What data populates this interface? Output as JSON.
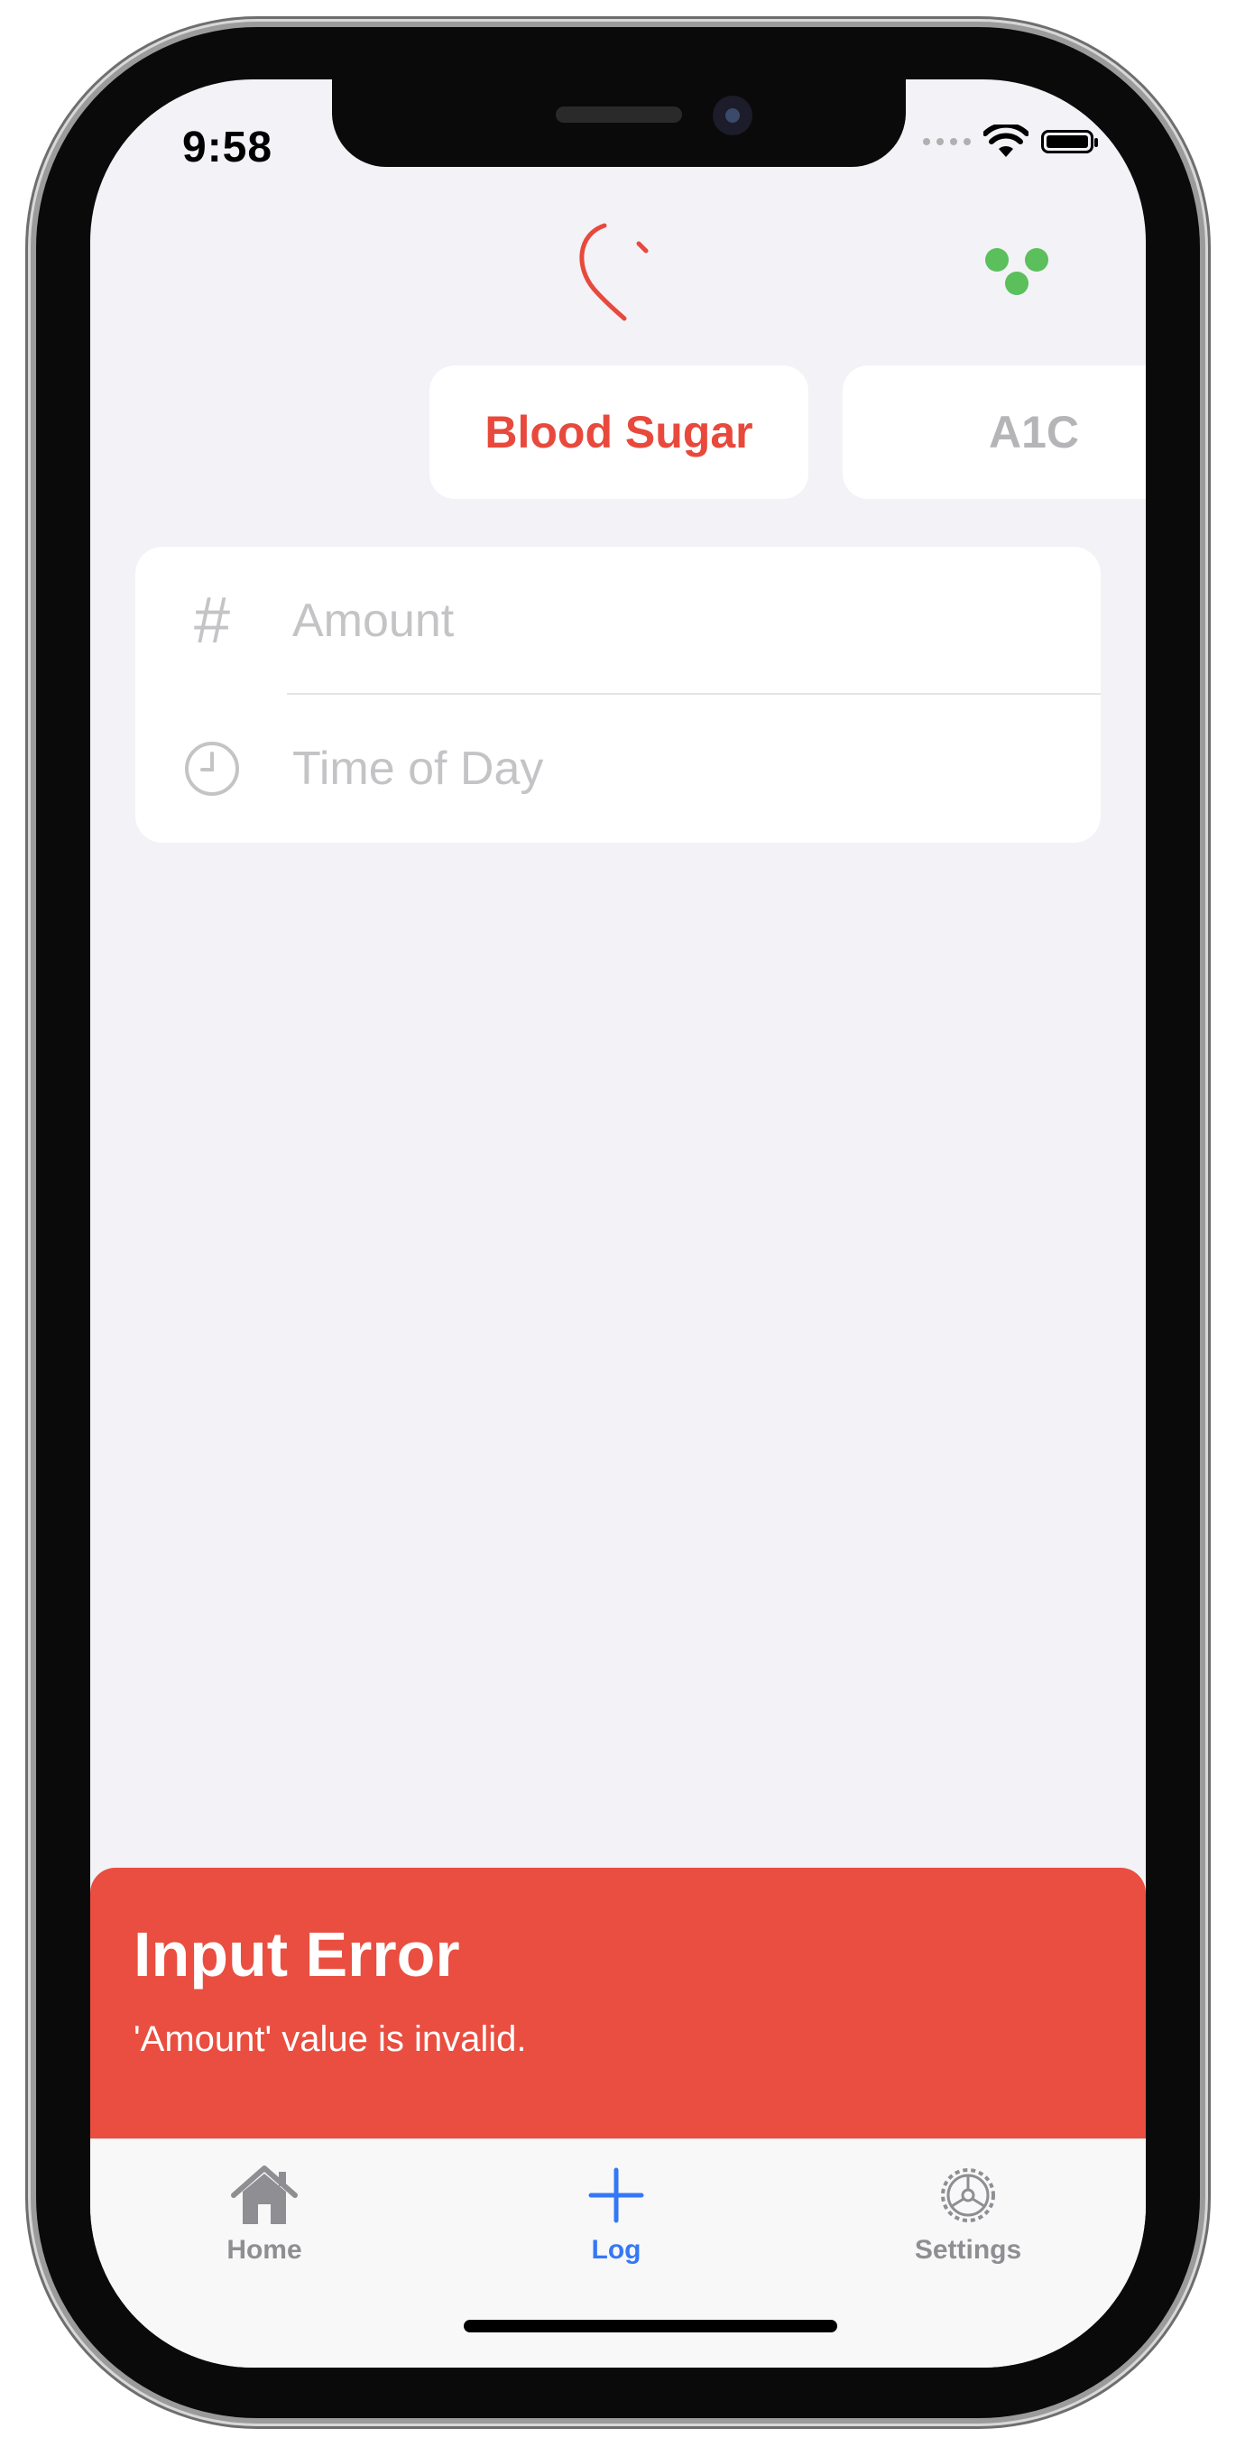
{
  "status_bar": {
    "time": "9:58"
  },
  "header": {
    "logo_icon": "heart-logo-icon",
    "menu_icon": "dots-menu-icon",
    "accent": "#e8493c",
    "menu_color": "#5bbf5b"
  },
  "segment_tabs": [
    {
      "label": "Blood Sugar",
      "selected": true
    },
    {
      "label": "A1C",
      "selected": false
    }
  ],
  "form": {
    "amount": {
      "placeholder": "Amount",
      "value": "",
      "icon": "hash-icon"
    },
    "time_of_day": {
      "placeholder": "Time of Day",
      "value": "",
      "icon": "clock-icon"
    }
  },
  "error_toast": {
    "title": "Input Error",
    "message": "'Amount' value is invalid.",
    "color": "#e94e40"
  },
  "tab_bar": {
    "items": [
      {
        "label": "Home",
        "icon": "home-icon",
        "active": false
      },
      {
        "label": "Log",
        "icon": "plus-icon",
        "active": true
      },
      {
        "label": "Settings",
        "icon": "gear-icon",
        "active": false
      }
    ],
    "active_color": "#3478f6",
    "inactive_color": "#8e8e93"
  }
}
